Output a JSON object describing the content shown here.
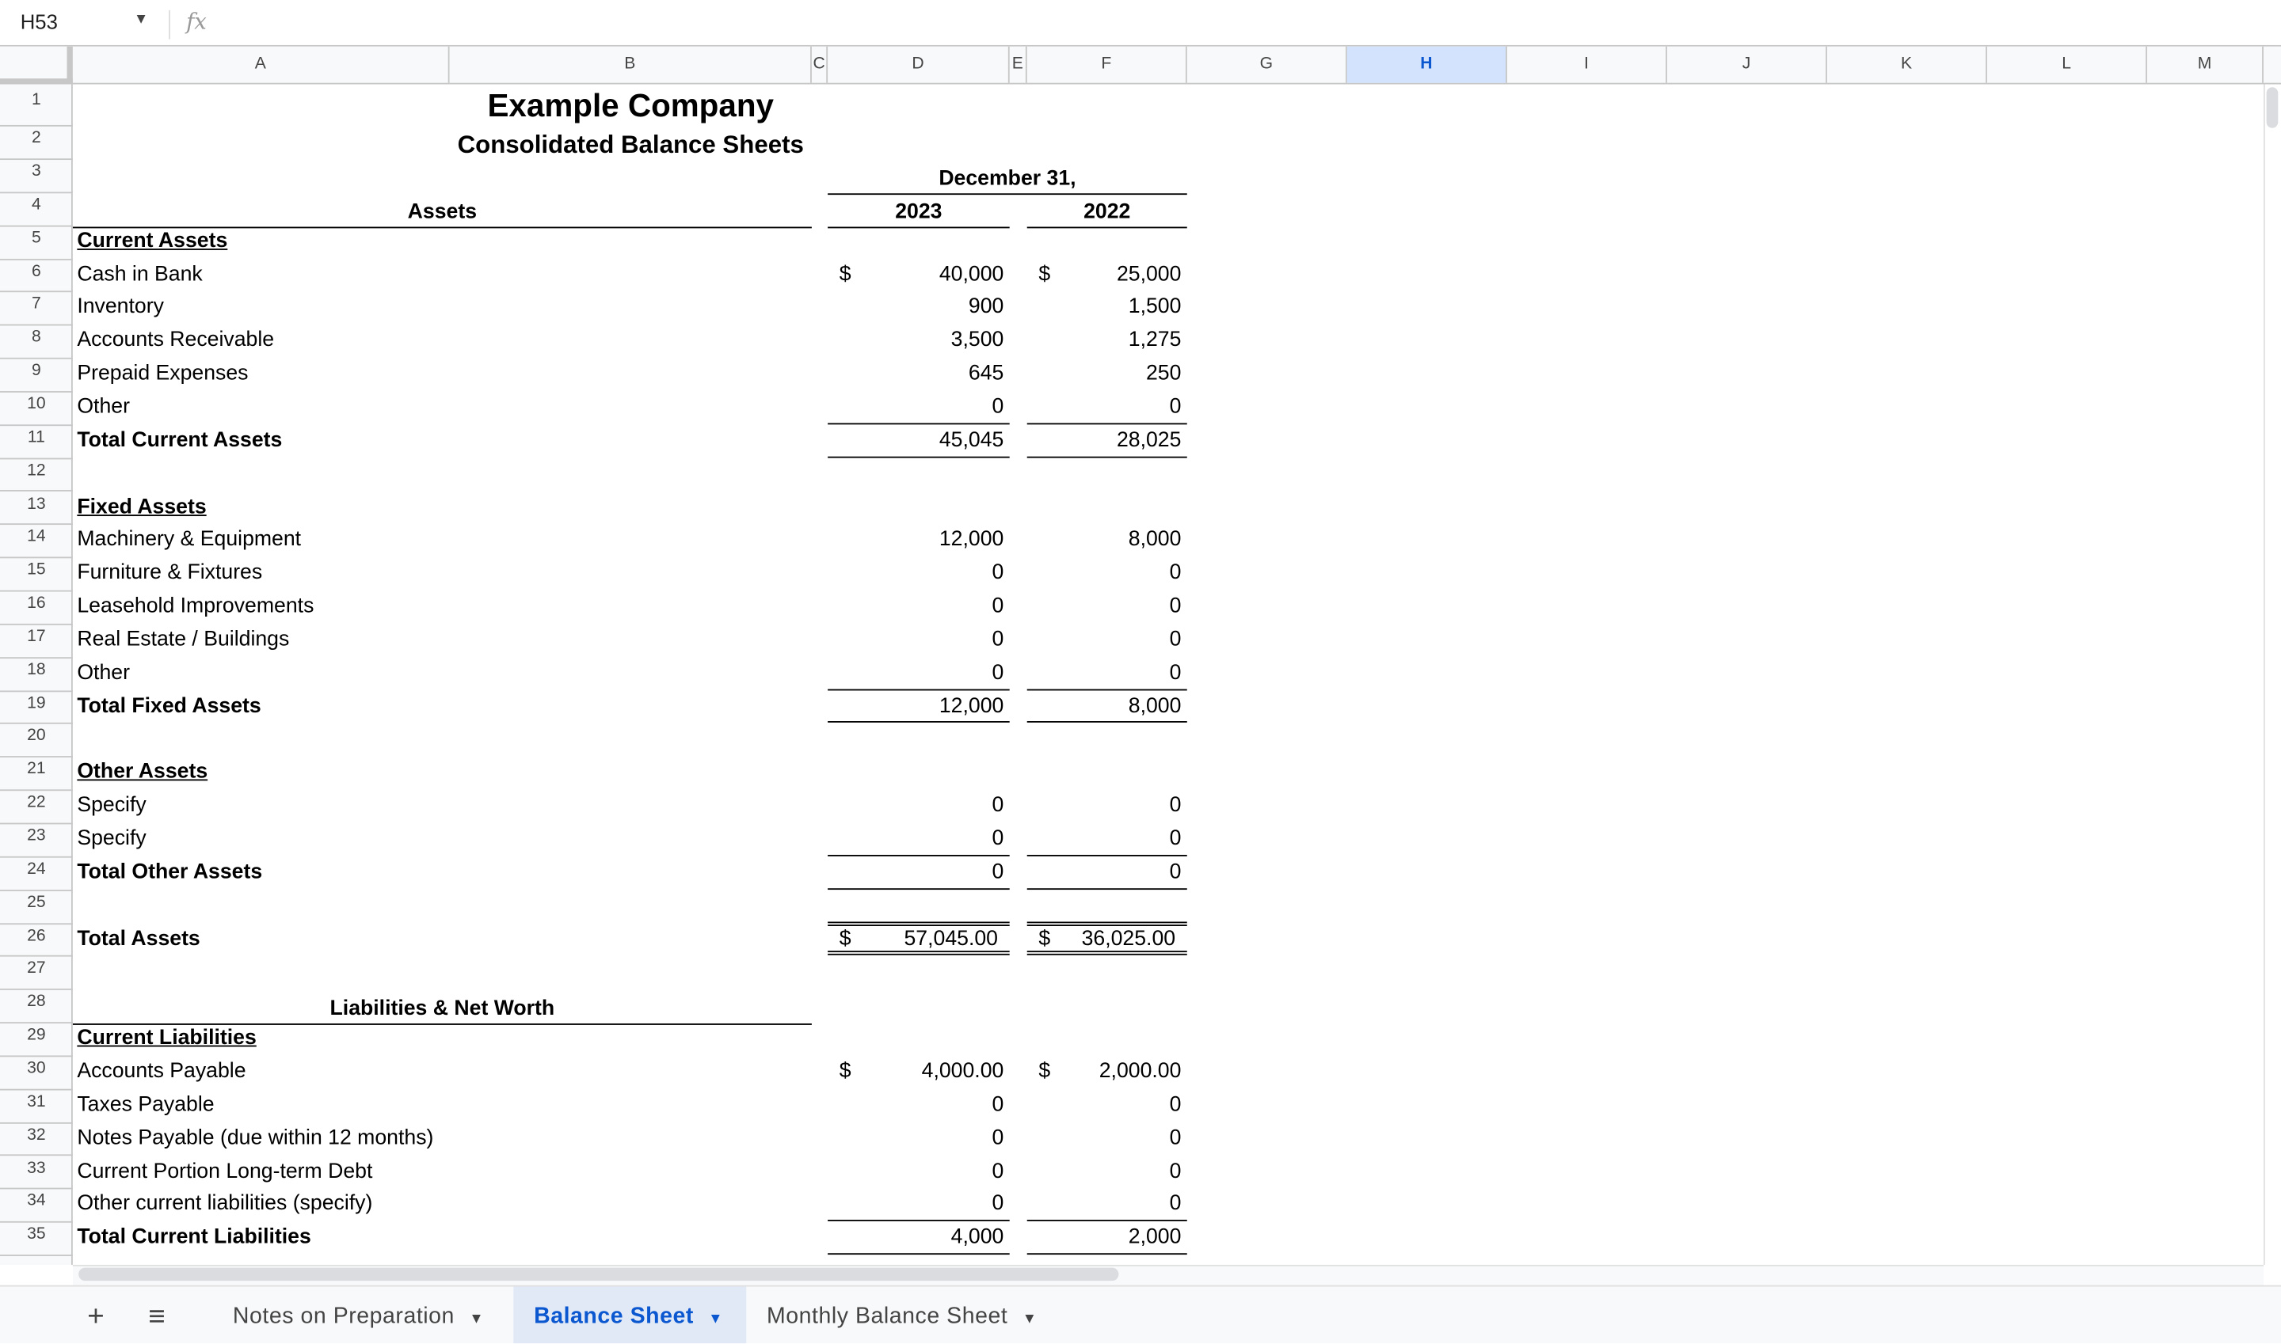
{
  "formula_bar": {
    "name_box": "H53",
    "fx_label": "fx",
    "formula": ""
  },
  "columns": [
    "A",
    "B",
    "C",
    "D",
    "E",
    "F",
    "G",
    "H",
    "I",
    "J",
    "K",
    "L",
    "M"
  ],
  "selected_column": "H",
  "accent_color": "#0b57d0",
  "header": {
    "title": "Example Company",
    "subtitle": "Consolidated Balance Sheets",
    "period": "December 31,",
    "assets_heading": "Assets",
    "year1": "2023",
    "year2": "2022",
    "liab_heading": "Liabilities & Net Worth"
  },
  "rows": [
    {
      "n": 1
    },
    {
      "n": 2
    },
    {
      "n": 3
    },
    {
      "n": 4
    },
    {
      "n": 5,
      "a": "Current Assets",
      "style": "section"
    },
    {
      "n": 6,
      "a": "Cash in Bank",
      "d": "40,000",
      "f": "25,000",
      "dollar": true
    },
    {
      "n": 7,
      "a": "Inventory",
      "d": "900",
      "f": "1,500"
    },
    {
      "n": 8,
      "a": "Accounts Receivable",
      "d": "3,500",
      "f": "1,275"
    },
    {
      "n": 9,
      "a": "Prepaid Expenses",
      "d": "645",
      "f": "250"
    },
    {
      "n": 10,
      "a": "Other",
      "d": "0",
      "f": "0",
      "style": "under"
    },
    {
      "n": 11,
      "a": "Total Current Assets",
      "d": "45,045",
      "f": "28,025",
      "style": "total"
    },
    {
      "n": 12
    },
    {
      "n": 13,
      "a": "Fixed Assets",
      "style": "section"
    },
    {
      "n": 14,
      "a": "Machinery & Equipment",
      "d": "12,000",
      "f": "8,000"
    },
    {
      "n": 15,
      "a": "Furniture & Fixtures",
      "d": "0",
      "f": "0"
    },
    {
      "n": 16,
      "a": "Leasehold Improvements",
      "d": "0",
      "f": "0"
    },
    {
      "n": 17,
      "a": "Real Estate / Buildings",
      "d": "0",
      "f": "0"
    },
    {
      "n": 18,
      "a": "Other",
      "d": "0",
      "f": "0",
      "style": "under"
    },
    {
      "n": 19,
      "a": "Total Fixed Assets",
      "d": "12,000",
      "f": "8,000",
      "style": "total"
    },
    {
      "n": 20
    },
    {
      "n": 21,
      "a": "Other Assets",
      "style": "section"
    },
    {
      "n": 22,
      "a": "Specify",
      "d": "0",
      "f": "0"
    },
    {
      "n": 23,
      "a": "Specify",
      "d": "0",
      "f": "0",
      "style": "under"
    },
    {
      "n": 24,
      "a": "Total Other Assets",
      "d": "0",
      "f": "0",
      "style": "total"
    },
    {
      "n": 25,
      "style": "under"
    },
    {
      "n": 26,
      "a": "Total Assets",
      "d": "57,045.00",
      "f": "36,025.00",
      "dollar": true,
      "style": "grand"
    },
    {
      "n": 27
    },
    {
      "n": 28
    },
    {
      "n": 29,
      "a": "Current Liabilities",
      "style": "section"
    },
    {
      "n": 30,
      "a": "Accounts Payable",
      "d": "4,000.00",
      "f": "2,000.00",
      "dollar": true
    },
    {
      "n": 31,
      "a": "Taxes Payable",
      "d": "0",
      "f": "0"
    },
    {
      "n": 32,
      "a": "Notes Payable (due within 12 months)",
      "d": "0",
      "f": "0"
    },
    {
      "n": 33,
      "a": "Current Portion Long-term Debt",
      "d": "0",
      "f": "0"
    },
    {
      "n": 34,
      "a": "Other current liabilities (specify)",
      "d": "0",
      "f": "0",
      "style": "under"
    },
    {
      "n": 35,
      "a": "Total Current Liabilities",
      "d": "4,000",
      "f": "2,000",
      "style": "total"
    }
  ],
  "currency_symbol": "$",
  "tabs": {
    "add_label": "+",
    "menu_label": "≡",
    "items": [
      {
        "label": "Notes on Preparation",
        "active": false
      },
      {
        "label": "Balance Sheet",
        "active": true
      },
      {
        "label": "Monthly Balance Sheet",
        "active": false
      }
    ]
  }
}
